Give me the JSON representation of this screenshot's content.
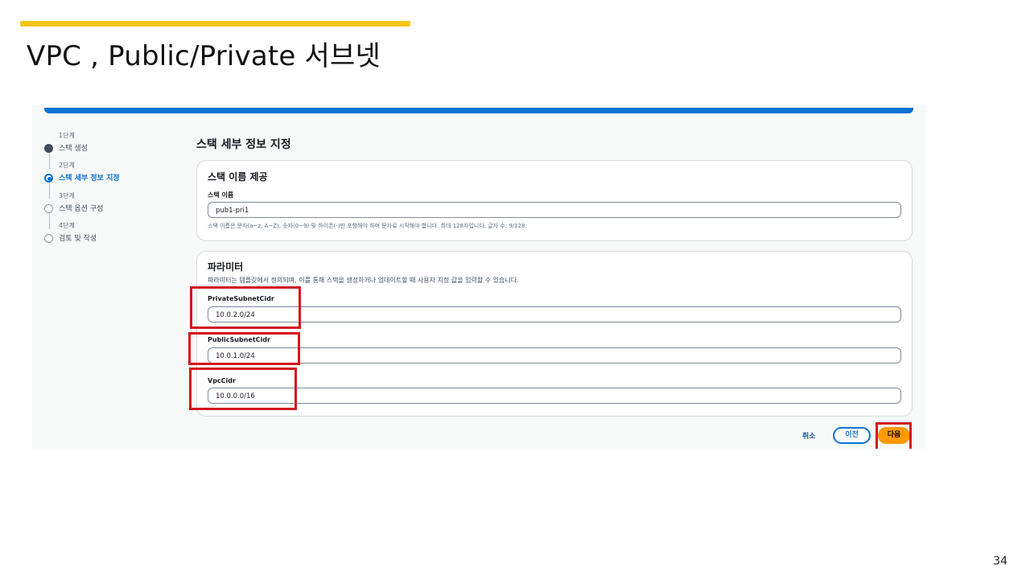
{
  "slide": {
    "title": "VPC , Public/Private 서브넷",
    "page_number": "34",
    "accent_color": "#f5c518"
  },
  "console": {
    "topbar_color": "#0972d3",
    "steps": [
      {
        "num": "1단계",
        "name": "스택 생성",
        "state": "done"
      },
      {
        "num": "2단계",
        "name": "스택 세부 정보 지정",
        "state": "active"
      },
      {
        "num": "3단계",
        "name": "스택 옵션 구성",
        "state": "pending"
      },
      {
        "num": "4단계",
        "name": "검토 및 작성",
        "state": "pending"
      }
    ],
    "heading": "스택 세부 정보 지정",
    "stack_name_card": {
      "title": "스택 이름 제공",
      "label": "스택 이름",
      "value": "pub1-pri1",
      "hint": "스택 이름은 문자(a~z, A~Z), 숫자(0~9) 및 하이픈(-)만 포함해야 하며 문자로 시작해야 합니다. 최대 128자입니다. 글자 수: 9/128."
    },
    "parameters_card": {
      "title": "파라미터",
      "description": "파라미터는 템플릿에서 정의되며, 이를 통해 스택을 생성하거나 업데이트할 때 사용자 지정 값을 입력할 수 있습니다.",
      "fields": [
        {
          "label": "PrivateSubnetCidr",
          "value": "10.0.2.0/24"
        },
        {
          "label": "PublicSubnetCidr",
          "value": "10.0.1.0/24"
        },
        {
          "label": "VpcCidr",
          "value": "10.0.0.0/16"
        }
      ]
    },
    "actions": {
      "cancel": "취소",
      "previous": "이전",
      "next": "다음",
      "next_color": "#ff9900"
    },
    "highlight_color": "#d0191c"
  }
}
